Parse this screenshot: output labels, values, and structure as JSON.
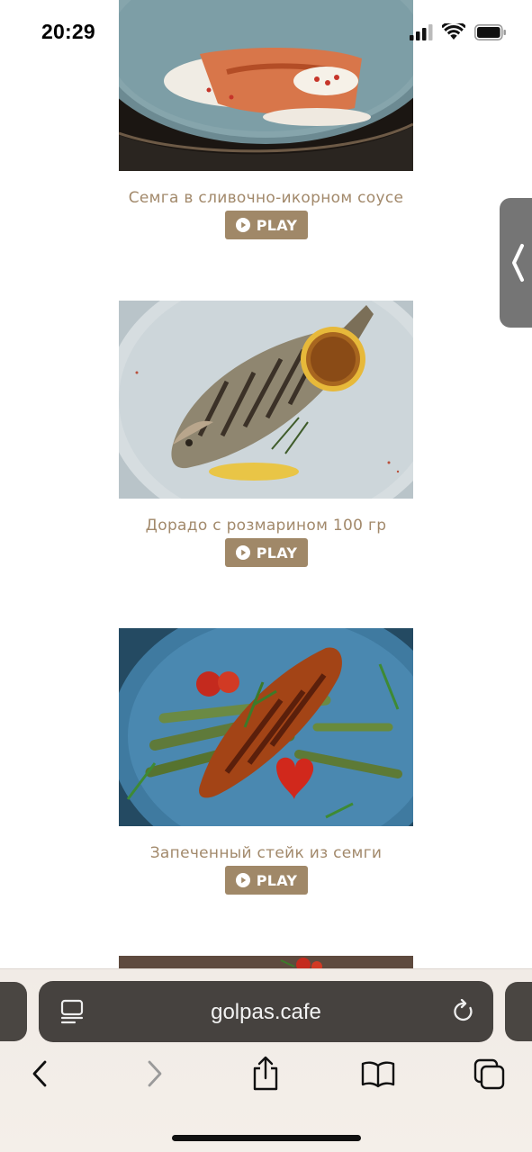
{
  "status_bar": {
    "time": "20:29"
  },
  "dishes": [
    {
      "title": "Семга в сливочно-икорном соусе",
      "play_label": "PLAY"
    },
    {
      "title": "Дорадо с розмарином 100 гр",
      "play_label": "PLAY"
    },
    {
      "title": "Запеченный стейк из семги",
      "play_label": "PLAY"
    }
  ],
  "browser": {
    "url": "golpas.cafe"
  },
  "icons": {
    "reader": "reader-icon",
    "reload": "reload-icon",
    "back": "chevron-left-icon",
    "forward": "chevron-right-icon",
    "share": "share-icon",
    "bookmarks": "book-icon",
    "tabs": "tabs-icon",
    "side_handle": "chevron-left-icon"
  },
  "colors": {
    "accent": "#a08868",
    "title_text": "#a2896b",
    "url_bar": "#46423f"
  }
}
